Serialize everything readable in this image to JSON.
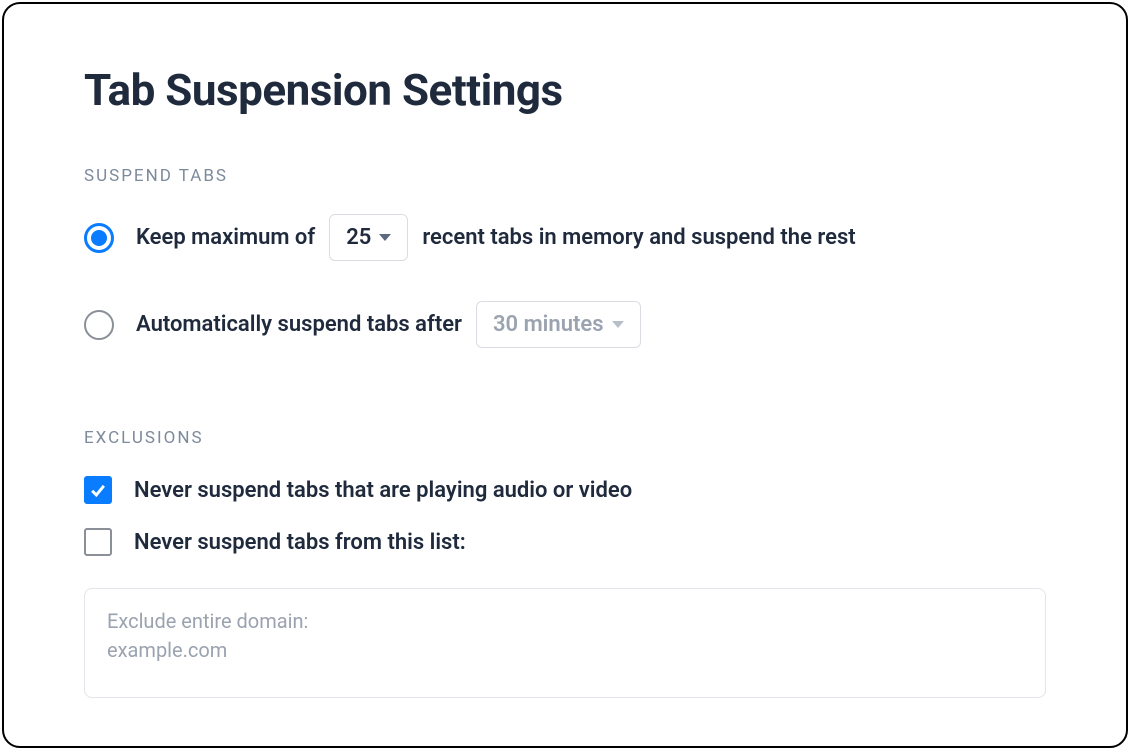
{
  "title": "Tab Suspension Settings",
  "suspend_section": {
    "header": "SUSPEND TABS",
    "option_max": {
      "prefix": "Keep maximum of",
      "value": "25",
      "suffix": "recent tabs in memory and suspend the rest",
      "selected": true
    },
    "option_auto": {
      "prefix": "Automatically suspend tabs after",
      "value": "30 minutes",
      "selected": false
    }
  },
  "exclusions_section": {
    "header": "EXCLUSIONS",
    "never_suspend_media": {
      "label": "Never suspend tabs that are playing audio or video",
      "checked": true
    },
    "never_suspend_list": {
      "label": "Never suspend tabs from this list:",
      "checked": false
    },
    "list_textarea": {
      "value": "",
      "placeholder": "Exclude entire domain:\nexample.com"
    }
  }
}
